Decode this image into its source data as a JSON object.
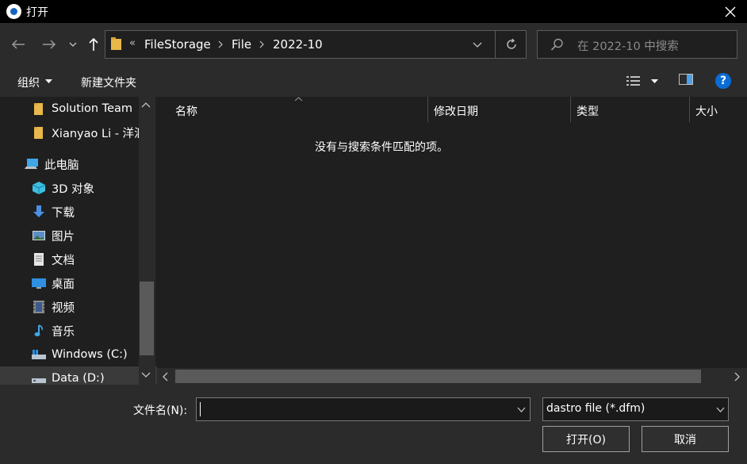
{
  "window": {
    "title": "打开",
    "close_icon": "close-icon"
  },
  "nav": {
    "back_icon": "arrow-left-icon",
    "forward_icon": "arrow-right-icon",
    "recent_icon": "chevron-down-icon",
    "up_icon": "arrow-up-icon",
    "overflow": "«",
    "breadcrumbs": [
      "FileStorage",
      "File",
      "2022-10"
    ],
    "refresh_icon": "refresh-icon",
    "search_placeholder": "在 2022-10 中搜索"
  },
  "toolbar": {
    "organize_label": "组织",
    "new_folder_label": "新建文件夹"
  },
  "tree": {
    "items": [
      {
        "label": "Solution Team",
        "icon": "folder-icon"
      },
      {
        "label": "Xianyao Li - 洋洄",
        "icon": "folder-icon"
      },
      {
        "label": "此电脑",
        "icon": "computer-icon"
      },
      {
        "label": "3D 对象",
        "icon": "cube-icon"
      },
      {
        "label": "下载",
        "icon": "download-icon"
      },
      {
        "label": "图片",
        "icon": "picture-icon"
      },
      {
        "label": "文档",
        "icon": "document-icon"
      },
      {
        "label": "桌面",
        "icon": "desktop-icon"
      },
      {
        "label": "视频",
        "icon": "video-icon"
      },
      {
        "label": "音乐",
        "icon": "music-icon"
      },
      {
        "label": "Windows (C:)",
        "icon": "drive-icon"
      },
      {
        "label": "Data (D:)",
        "icon": "drive-icon"
      }
    ]
  },
  "list": {
    "columns": [
      "名称",
      "修改日期",
      "类型",
      "大小"
    ],
    "empty_message": "没有与搜索条件匹配的项。"
  },
  "bottom": {
    "filename_label": "文件名(N):",
    "filename_value": "",
    "filter_value": "dastro file (*.dfm)",
    "open_label": "打开(O)",
    "cancel_label": "取消"
  },
  "colors": {
    "background": "#202020",
    "panel": "#2b2b2b",
    "help_blue": "#0a6cd6",
    "folder_yellow": "#e8b84a"
  }
}
